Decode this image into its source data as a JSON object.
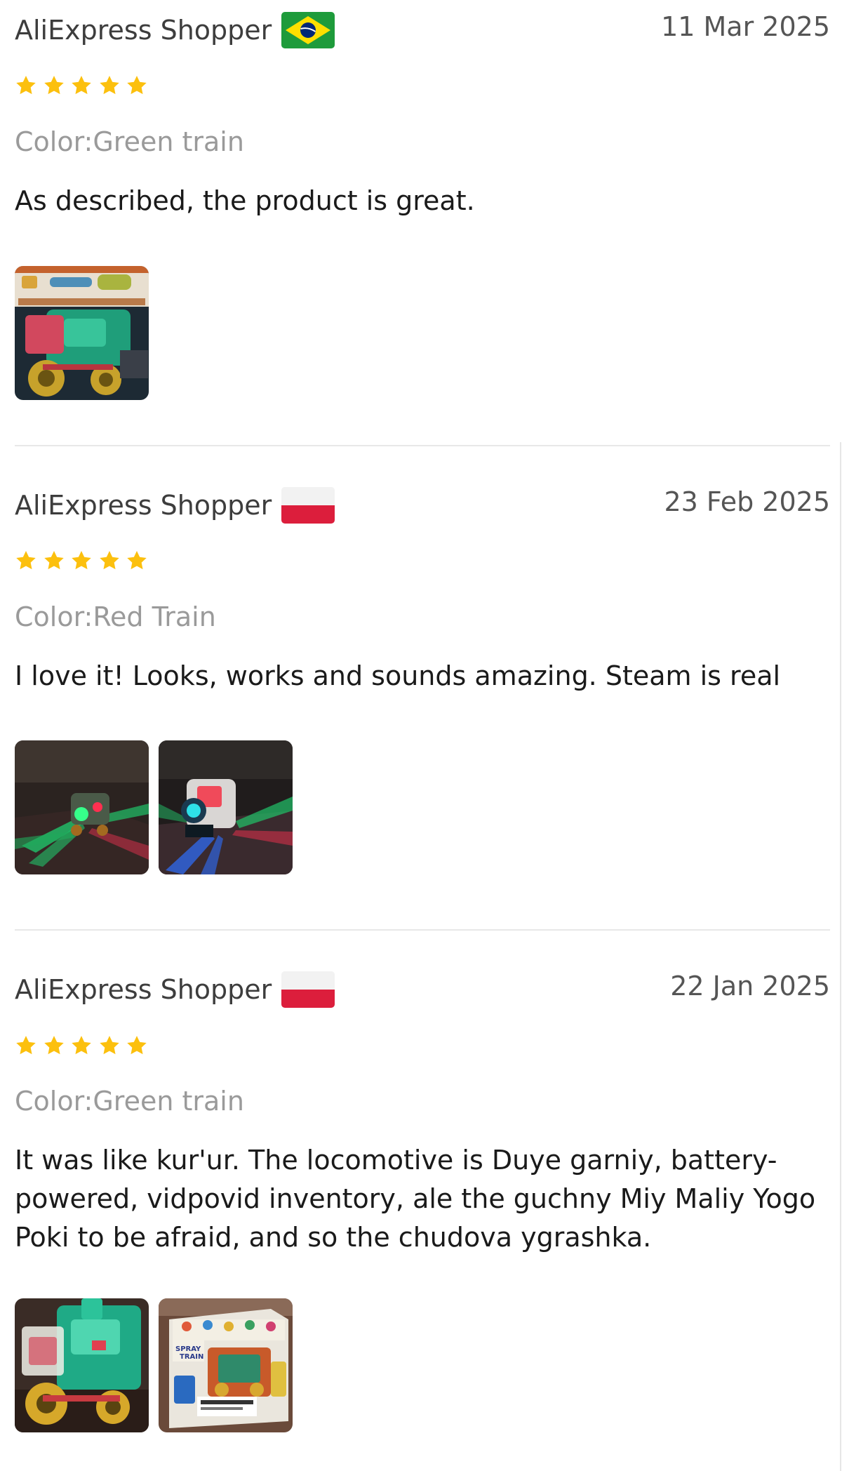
{
  "reviews": [
    {
      "reviewer": "AliExpress Shopper",
      "country_flag": "brazil-flag-icon",
      "date": "11 Mar 2025",
      "rating": 5,
      "sku": "Color:Green train",
      "text": "As described, the product is great.",
      "photo_count": 1
    },
    {
      "reviewer": "AliExpress Shopper",
      "country_flag": "poland-flag-icon",
      "date": "23 Feb 2025",
      "rating": 5,
      "sku": "Color:Red Train",
      "text": "I love it! Looks, works and sounds amazing. Steam is real",
      "photo_count": 2
    },
    {
      "reviewer": "AliExpress Shopper",
      "country_flag": "poland-flag-icon",
      "date": "22 Jan 2025",
      "rating": 5,
      "sku": "Color:Green train",
      "text": "It was like kur'ur. The locomotive is Duye garniy, battery-powered, vidpovid inventory, ale the guchny Miy Maliy Yogo Poki to be afraid, and so the chudova ygrashka.",
      "photo_count": 2
    }
  ],
  "colors": {
    "star": "#fcc00e",
    "meta_text": "#9a9a9a",
    "divider": "#e8e8e8"
  }
}
